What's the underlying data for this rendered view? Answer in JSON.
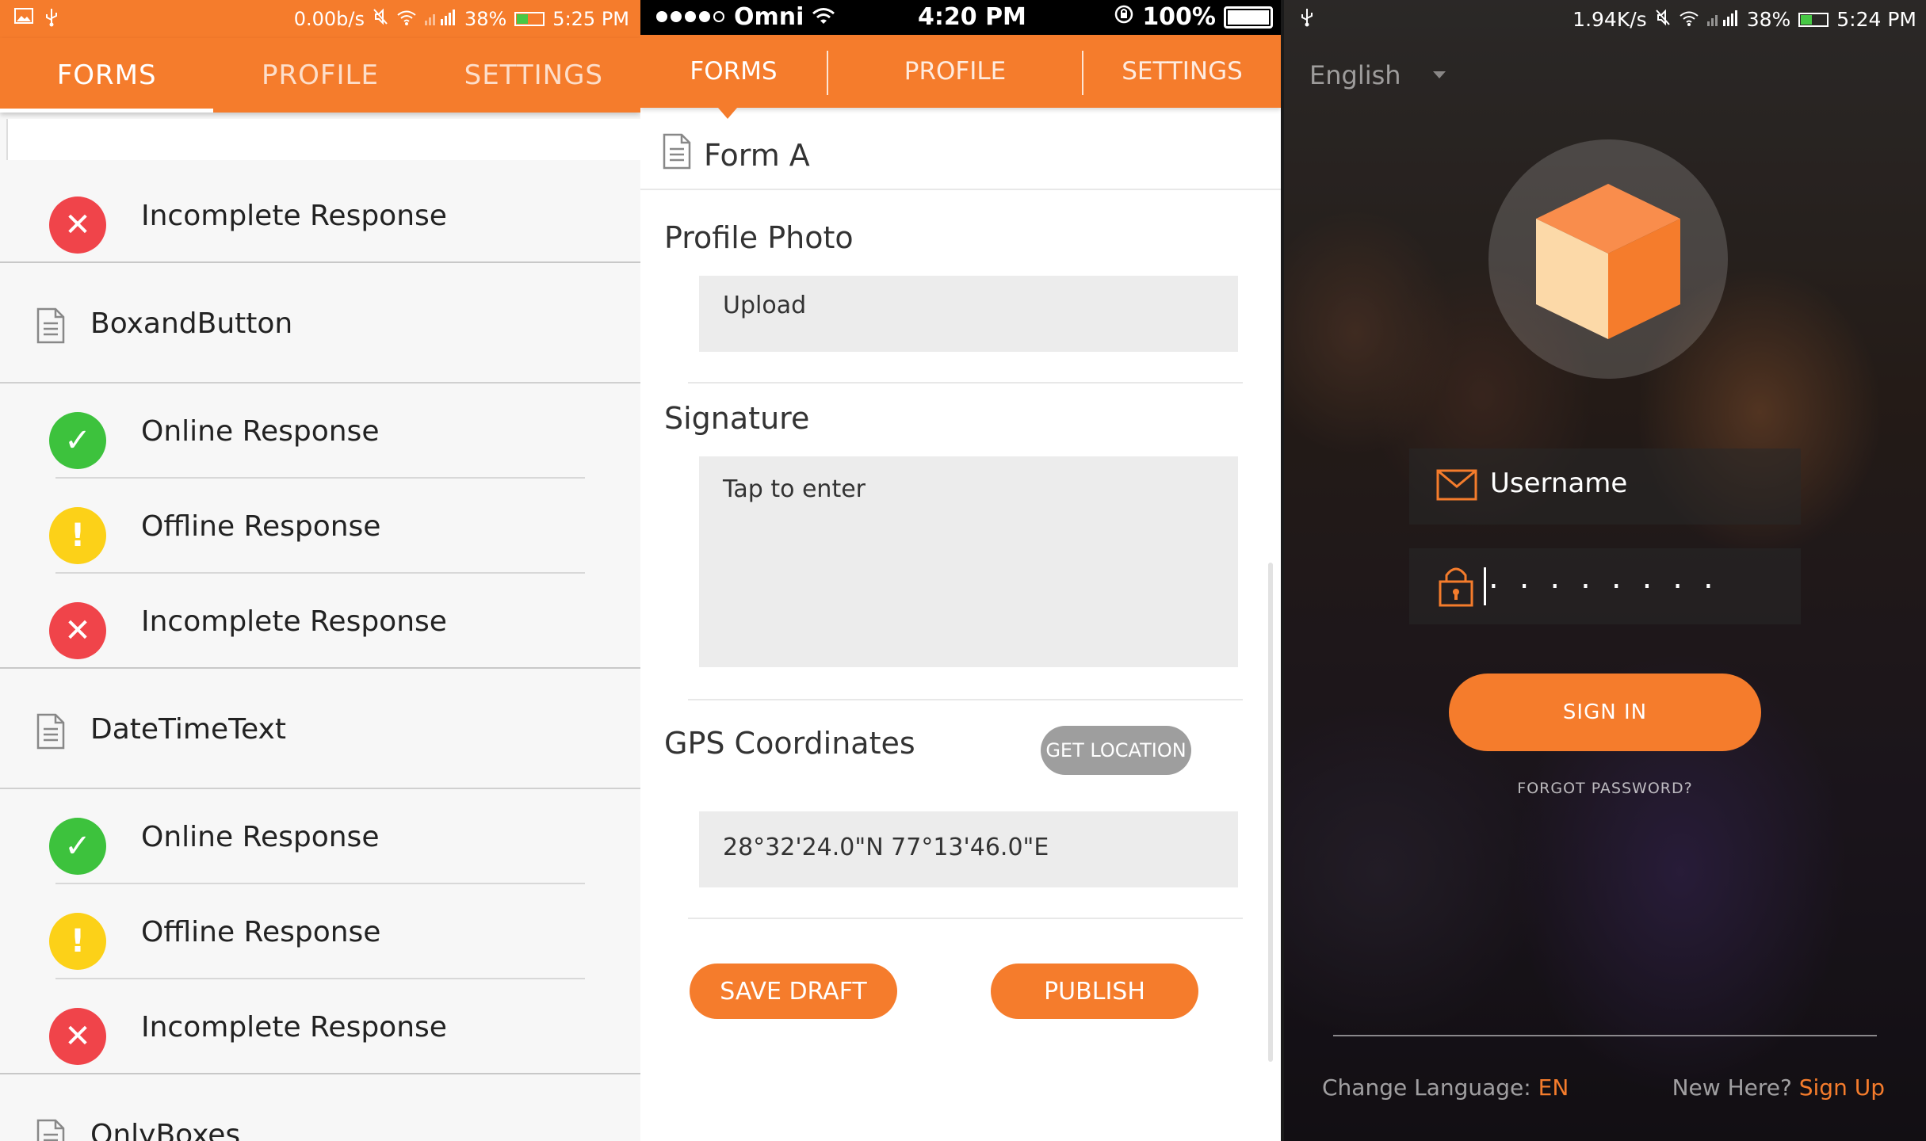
{
  "colors": {
    "accent": "#f57c2c",
    "error": "#f0444a",
    "success": "#3dc23d",
    "warning": "#fcd118",
    "field_bg": "#ececec",
    "grey_button": "#9e9e9e"
  },
  "panel1": {
    "status_bar": {
      "speed": "0.00b/s",
      "battery": "38%",
      "time": "5:25 PM"
    },
    "tabs": [
      "FORMS",
      "PROFILE",
      "SETTINGS"
    ],
    "active_tab": "FORMS",
    "items": [
      {
        "type": "response",
        "status": "incomplete",
        "label": "Incomplete Response"
      },
      {
        "type": "form",
        "label": "BoxandButton"
      },
      {
        "type": "response",
        "status": "online",
        "label": "Online Response"
      },
      {
        "type": "response",
        "status": "offline",
        "label": "Offline Response"
      },
      {
        "type": "response",
        "status": "incomplete",
        "label": "Incomplete Response"
      },
      {
        "type": "form",
        "label": "DateTimeText"
      },
      {
        "type": "response",
        "status": "online",
        "label": "Online Response"
      },
      {
        "type": "response",
        "status": "offline",
        "label": "Offline Response"
      },
      {
        "type": "response",
        "status": "incomplete",
        "label": "Incomplete Response"
      },
      {
        "type": "form",
        "label": "OnlyBoxes"
      }
    ]
  },
  "panel2": {
    "status_bar": {
      "carrier": "Omni",
      "time": "4:20 PM",
      "battery": "100%"
    },
    "tabs": [
      "FORMS",
      "PROFILE",
      "SETTINGS"
    ],
    "active_tab": "FORMS",
    "form_title": "Form A",
    "fields": {
      "profile_photo_label": "Profile Photo",
      "upload_label": "Upload",
      "signature_label": "Signature",
      "signature_placeholder": "Tap to enter",
      "gps_label": "GPS Coordinates",
      "get_location_label": "GET LOCATION",
      "gps_value": "28°32'24.0\"N 77°13'46.0\"E"
    },
    "buttons": {
      "save_draft": "SAVE DRAFT",
      "publish": "PUBLISH"
    }
  },
  "panel3": {
    "status_bar": {
      "speed": "1.94K/s",
      "battery": "38%",
      "time": "5:24 PM"
    },
    "language_select": "English",
    "username_placeholder": "Username",
    "password_dots": "........",
    "sign_in": "SIGN IN",
    "forgot_password": "FORGOT PASSWORD?",
    "change_language_label": "Change Language:",
    "change_language_value": "EN",
    "new_here_label": "New Here?",
    "sign_up": "Sign Up"
  }
}
